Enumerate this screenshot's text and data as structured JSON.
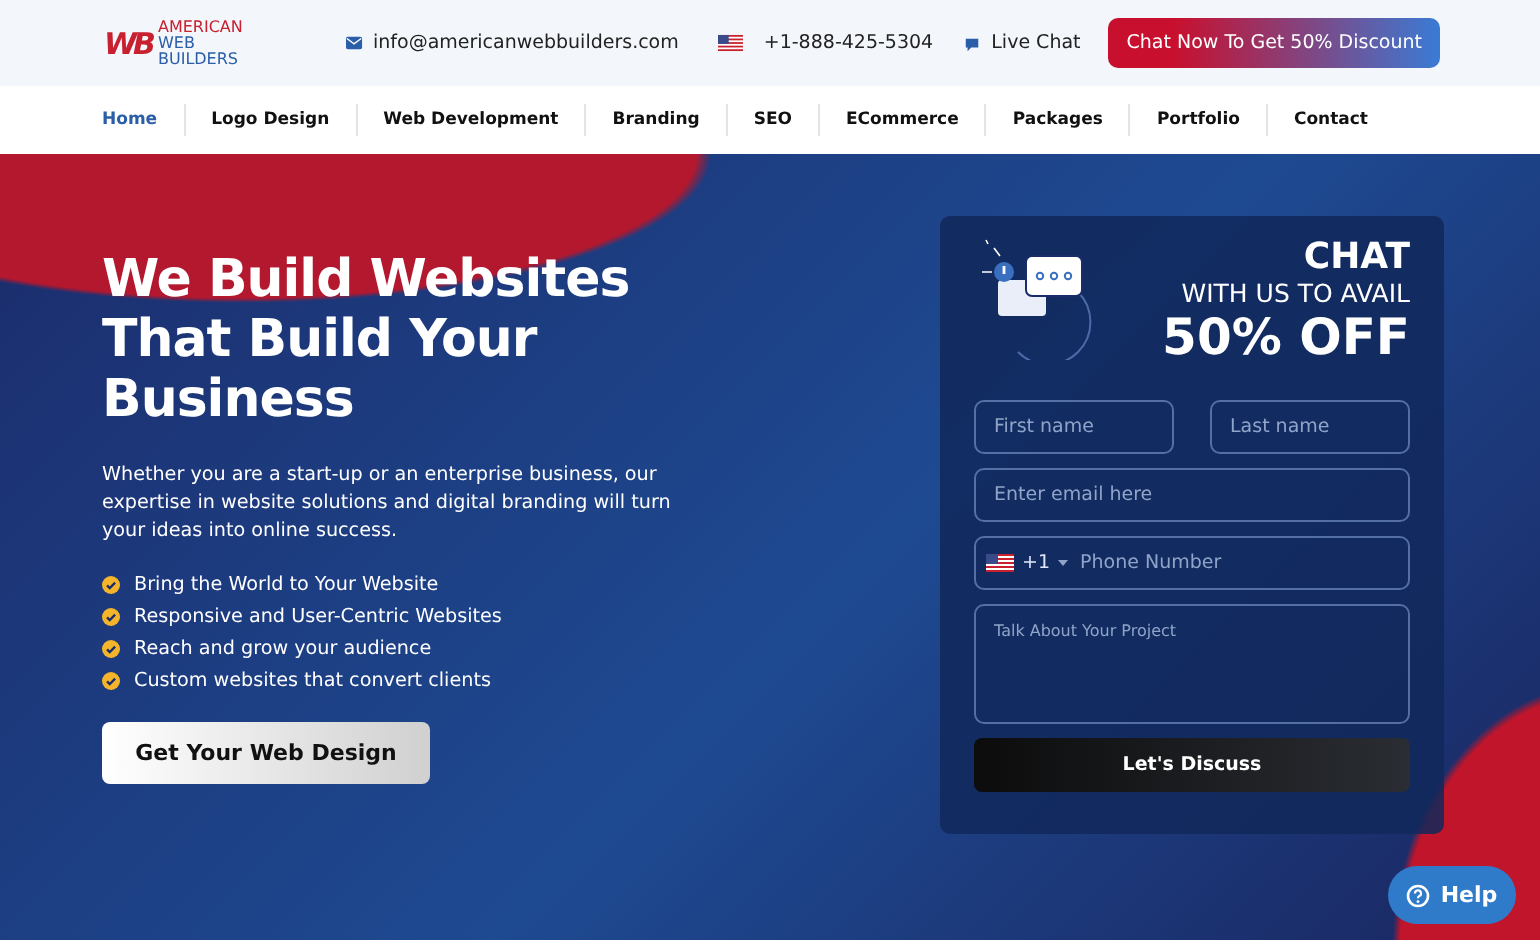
{
  "topbar": {
    "logo_mark": "WB",
    "logo_line1": "AMERICAN",
    "logo_line2": "WEB BUILDERS",
    "email": "info@americanwebbuilders.com",
    "phone": "+1-888-425-5304",
    "live_chat": "Live Chat",
    "cta": "Chat Now To Get 50% Discount"
  },
  "nav": [
    {
      "label": "Home",
      "selected": true
    },
    {
      "label": "Logo Design",
      "selected": false
    },
    {
      "label": "Web Development",
      "selected": false
    },
    {
      "label": "Branding",
      "selected": false
    },
    {
      "label": "SEO",
      "selected": false
    },
    {
      "label": "ECommerce",
      "selected": false
    },
    {
      "label": "Packages",
      "selected": false
    },
    {
      "label": "Portfolio",
      "selected": false
    },
    {
      "label": "Contact",
      "selected": false
    }
  ],
  "hero": {
    "title": "We Build Websites That Build Your Business",
    "text": "Whether you are a start-up or an enterprise business, our expertise in website solutions and digital branding will turn your ideas into online success.",
    "bullets": [
      "Bring the World to Your Website",
      "Responsive and User-Centric Websites",
      "Reach and grow your audience",
      "Custom websites that convert clients"
    ],
    "button": "Get Your Web Design"
  },
  "form": {
    "heading1": "CHAT",
    "heading2": "WITH US TO AVAIL",
    "heading3": "50% OFF",
    "first_name": {
      "placeholder": "First name"
    },
    "last_name": {
      "placeholder": "Last name"
    },
    "email": {
      "placeholder": "Enter email here"
    },
    "dial_code": "+1",
    "phone": {
      "placeholder": "Phone Number"
    },
    "message": {
      "placeholder": "Talk About Your Project"
    },
    "submit": "Let's Discuss"
  },
  "help": "Help"
}
